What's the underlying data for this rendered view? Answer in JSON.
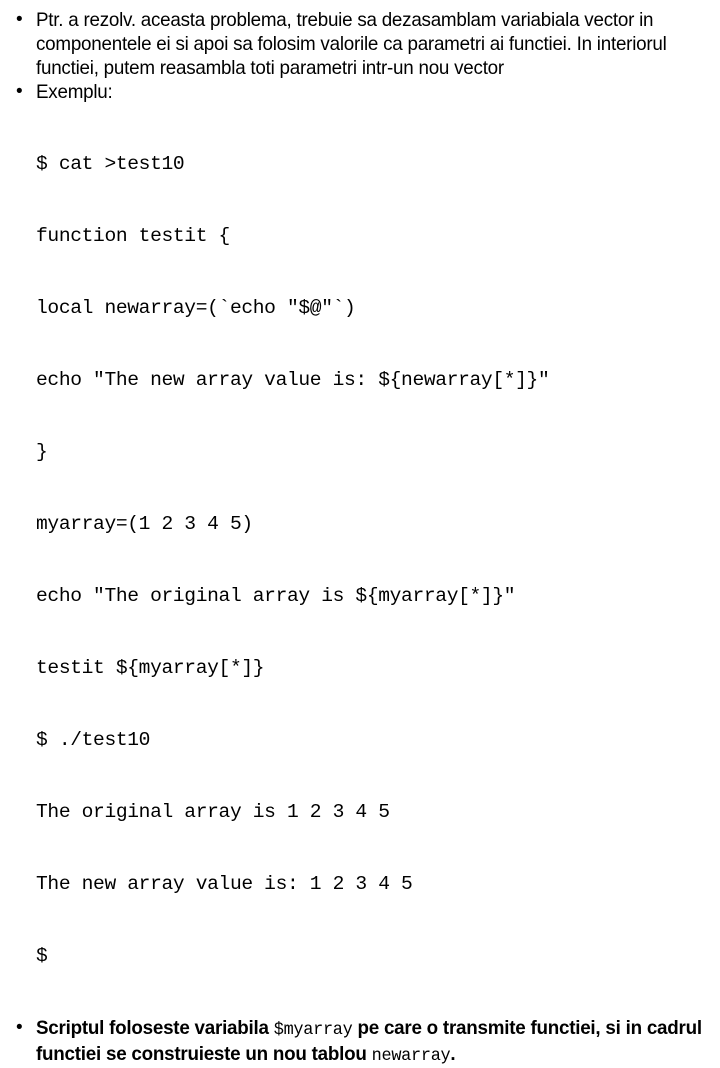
{
  "slide": {
    "background_color": "#ffffff",
    "text_color": "#000000",
    "bullet_glyph": "•"
  },
  "bullets": [
    {
      "id": "intro-paragraph",
      "text": "Ptr. a rezolv. aceasta problema, trebuie sa dezasamblam variabiala vector in componentele ei si apoi sa folosim valorile ca parametri ai functiei. In interiorul functiei, putem reasambla toti parametri intr-un nou vector",
      "bold": false
    },
    {
      "id": "example-label",
      "text": "Exemplu:",
      "bold": false
    }
  ],
  "code": {
    "lines": [
      "$ cat >test10",
      "function testit {",
      "local newarray=(`echo \"$@\"`)",
      "echo \"The new array value is: ${newarray[*]}\"",
      "}",
      "myarray=(1 2 3 4 5)",
      "echo \"The original array is ${myarray[*]}\"",
      "testit ${myarray[*]}",
      "$ ./test10",
      "The original array is 1 2 3 4 5",
      "The new array value is: 1 2 3 4 5",
      "$"
    ]
  },
  "conclusion": {
    "bold": true,
    "segment_1": "Scriptul foloseste variabila ",
    "mono_1": "$myarray",
    "segment_2": " pe care o transmite functiei, si in cadrul functiei se construieste un nou tablou ",
    "mono_2": "newarray",
    "segment_3": "."
  }
}
